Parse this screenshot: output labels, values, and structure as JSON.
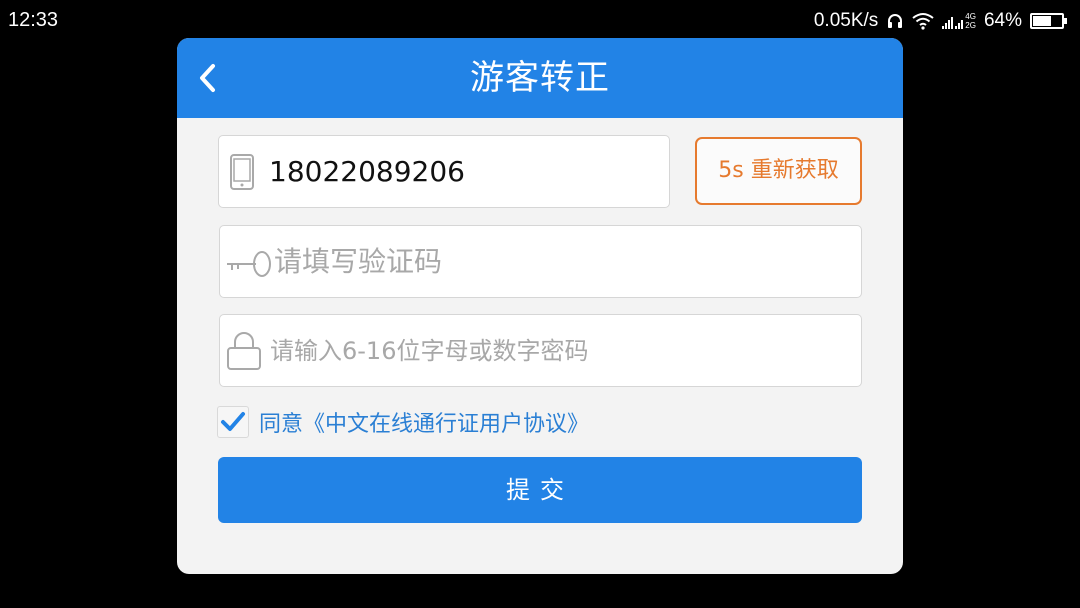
{
  "status_bar": {
    "time": "12:33",
    "net_speed": "0.05K/s",
    "network_labels": [
      "4G",
      "2G"
    ],
    "battery": "64%",
    "battery_level": 0.64,
    "icons": [
      "headphones-icon",
      "wifi-icon",
      "signal-icon",
      "battery-icon"
    ]
  },
  "dialog": {
    "title": "游客转正",
    "back_icon": "chevron-left-icon",
    "phone": {
      "value": "18022089206",
      "icon": "phone-icon"
    },
    "resend_label": "5s 重新获取",
    "code": {
      "placeholder": "请填写验证码",
      "icon": "key-icon"
    },
    "password": {
      "placeholder": "请输入6-16位字母或数字密码",
      "icon": "lock-icon"
    },
    "agreement": {
      "checked": true,
      "text": "同意《中文在线通行证用户协议》"
    },
    "submit_label": "提交"
  },
  "colors": {
    "header": "#2283e6",
    "primary_button": "#2283e6",
    "resend": "#e67a2e",
    "link": "#2a7fd4",
    "panel": "#f3f3f3"
  }
}
